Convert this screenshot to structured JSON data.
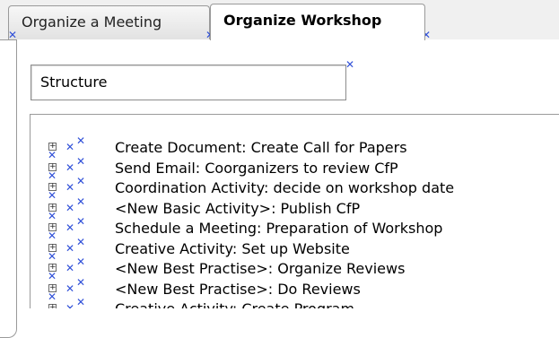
{
  "tabs": [
    {
      "label": "Organize a Meeting",
      "active": false
    },
    {
      "label": "Organize Workshop",
      "active": true
    }
  ],
  "structure_field": {
    "value": "Structure"
  },
  "activities": [
    {
      "label": "Create Document: Create Call for Papers"
    },
    {
      "label": "Send Email: Coorganizers to review CfP"
    },
    {
      "label": "Coordination Activity: decide on workshop date"
    },
    {
      "label": "<New Basic Activity>: Publish CfP"
    },
    {
      "label": "Schedule a Meeting:  Preparation of Workshop"
    },
    {
      "label": "Creative Activity: Set up Website"
    },
    {
      "label": "<New Best Practise>: Organize Reviews"
    },
    {
      "label": "<New Best Practise>: Do Reviews"
    },
    {
      "label": "Creative Activity: Create Program"
    }
  ],
  "icons": {
    "expander": "plus-box-icon",
    "marker": "x-marker-icon"
  },
  "colors": {
    "marker": "#3050d8",
    "border": "#9a9a9a"
  }
}
